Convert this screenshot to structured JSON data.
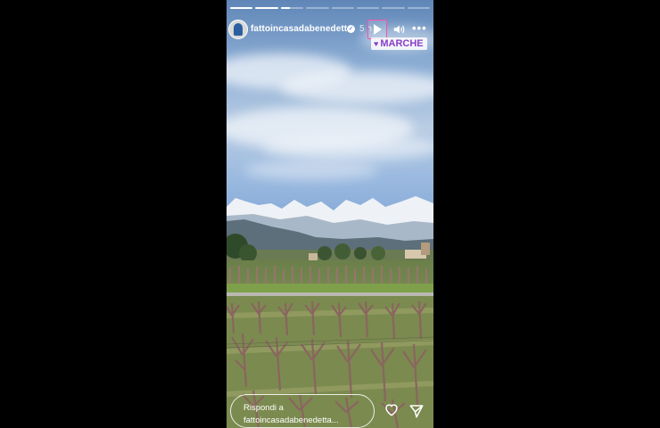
{
  "story": {
    "progress": {
      "segments": 8,
      "completed": 2,
      "current_fraction": 0.4
    },
    "header": {
      "username": "fattoincasadabenedetta",
      "verified": true,
      "time_label": "5 h",
      "more_glyph": "•••"
    },
    "location_sticker": {
      "heart": "♥",
      "label": "MARCHE"
    },
    "footer": {
      "reply_placeholder": "Rispondi a fattoincasadabenedetta..."
    },
    "icons": {
      "play": "play-icon",
      "volume": "volume-icon",
      "like": "heart-icon",
      "share": "send-icon"
    },
    "colors": {
      "play_highlight": "#ff4fa8",
      "sticker_text": "#8a3ec9"
    }
  }
}
